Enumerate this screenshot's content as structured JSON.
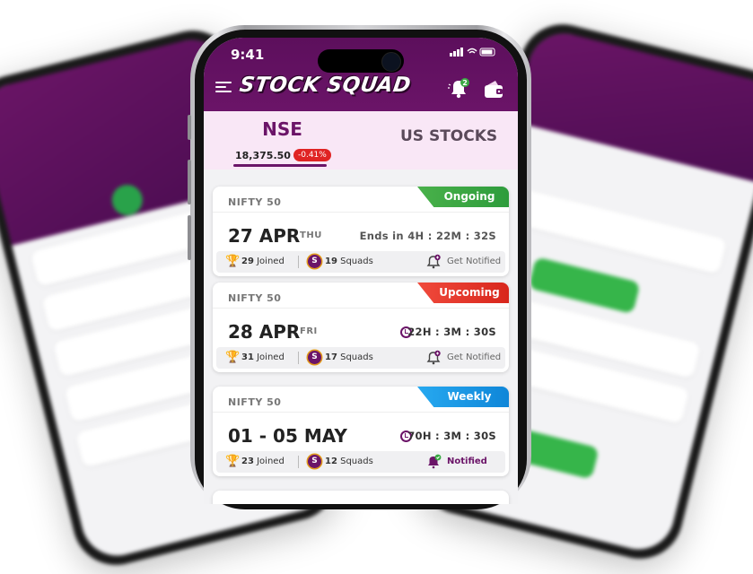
{
  "status_bar": {
    "time": "9:41"
  },
  "header": {
    "logo": "STOCK SQUAD"
  },
  "tabs": {
    "nse": {
      "label": "NSE",
      "value": "18,375.50",
      "change": "-0.41%"
    },
    "us": {
      "label": "US STOCKS"
    }
  },
  "cards": [
    {
      "index": "NIFTY 50",
      "badge": "Ongoing",
      "date": "27 APR",
      "day": "THU",
      "timer": "Ends in 4H : 22M : 32S",
      "joined_count": "29",
      "joined_label": "Joined",
      "squads_count": "19",
      "squads_label": "Squads",
      "notify_label": "Get Notified"
    },
    {
      "index": "NIFTY 50",
      "badge": "Upcoming",
      "date": "28 APR",
      "day": "FRI",
      "timer": "22H : 3M : 30S",
      "joined_count": "31",
      "joined_label": "Joined",
      "squads_count": "17",
      "squads_label": "Squads",
      "notify_label": "Get Notified"
    },
    {
      "index": "NIFTY 50",
      "badge": "Weekly",
      "date": "01 - 05 MAY",
      "day": "",
      "timer": "70H : 3M : 30S",
      "joined_count": "23",
      "joined_label": "Joined",
      "squads_count": "12",
      "squads_label": "Squads",
      "notify_label": "Notified"
    }
  ],
  "colors": {
    "brand": "#6b1468",
    "ongoing": "#3aa843",
    "upcoming": "#e6342a",
    "weekly": "#1a9ae6",
    "negative": "#e02424"
  },
  "icons": [
    "menu-icon",
    "bell-icon",
    "wallet-icon",
    "trophy-icon",
    "squad-icon",
    "clock-icon",
    "notify-bell-icon"
  ]
}
